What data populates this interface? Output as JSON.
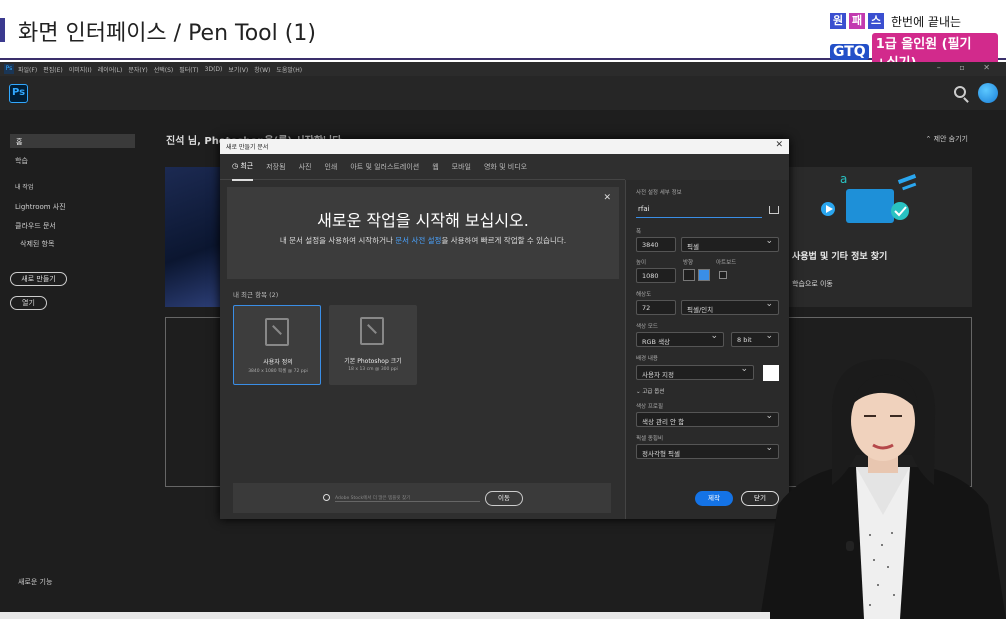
{
  "banner": {
    "title": "화면 인터페이스 / Pen Tool (1)",
    "logo_chars": [
      "원",
      "패",
      "스"
    ],
    "logo_slogan": "한번에 끝내는",
    "logo_gtq": "GTQ",
    "logo_course": "1급 올인원 (필기+실기)",
    "accent_color": "#3b3a8f"
  },
  "ps": {
    "logo_text": "Ps",
    "menu": [
      "파일(F)",
      "편집(E)",
      "이미지(I)",
      "레이어(L)",
      "문자(Y)",
      "선택(S)",
      "필터(T)",
      "3D(D)",
      "보기(V)",
      "창(W)",
      "도움말(H)"
    ],
    "window_controls": "– ▫ ✕",
    "sidebar": {
      "home": "홈",
      "learn": "학습",
      "my_work": "내 작업",
      "lightroom": "Lightroom 사진",
      "cloud_docs": "클라우드 문서",
      "deleted": "삭제된 항목",
      "new_button": "새로 만들기",
      "open_button": "열기",
      "whats_new": "새로운 기능"
    },
    "home": {
      "greeting": "진석 님, Photoshop을(를) 시작합니다.",
      "hide_tips": "제안 숨기기",
      "card_title": "사용법 및 기타 정보 찾기",
      "card_link": "학습으로 이동"
    }
  },
  "dialog": {
    "title": "새로 만들기 문서",
    "tabs": [
      "최근",
      "저장됨",
      "사진",
      "인쇄",
      "아트 및 일러스트레이션",
      "웹",
      "모바일",
      "영화 및 비디오"
    ],
    "welcome_heading": "새로운 작업을 시작해 보십시오.",
    "welcome_desc_a": "내 문서 설정을 사용하여 시작하거나 ",
    "welcome_desc_link": "문서 사전 설정",
    "welcome_desc_b": "을 사용하여 빠르게 작업할 수 있습니다.",
    "recent_label": "내 최근 항목 (2)",
    "presets": [
      {
        "name": "사용자 정의",
        "size": "3840 x 1080 픽셀 @ 72 ppi"
      },
      {
        "name": "기본 Photoshop 크기",
        "size": "18 x 13 cm @ 300 ppi"
      }
    ],
    "search_placeholder": "Adobe Stock에서 더 많은 템플릿 찾기",
    "search_go": "이동",
    "details_label": "사전 설정 세부 정보",
    "doc_name": "rfai",
    "width_label": "폭",
    "width_value": "3840",
    "width_unit": "픽셀",
    "height_label": "높이",
    "height_value": "1080",
    "orientation_label": "방향",
    "artboard_label": "아트보드",
    "resolution_label": "해상도",
    "resolution_value": "72",
    "resolution_unit": "픽셀/인치",
    "color_mode_label": "색상 모드",
    "color_mode_value": "RGB 색상",
    "bit_depth": "8 bit",
    "bg_label": "배경 내용",
    "bg_value": "사용자 지정",
    "bg_color": "#ffffff",
    "advanced_label": "고급 옵션",
    "profile_label": "색상 프로필",
    "profile_value": "색상 관리 안 함",
    "pixel_ratio_label": "픽셀 종횡비",
    "pixel_ratio_value": "정사각형 픽셀",
    "create_button": "제작",
    "close_button": "닫기"
  }
}
